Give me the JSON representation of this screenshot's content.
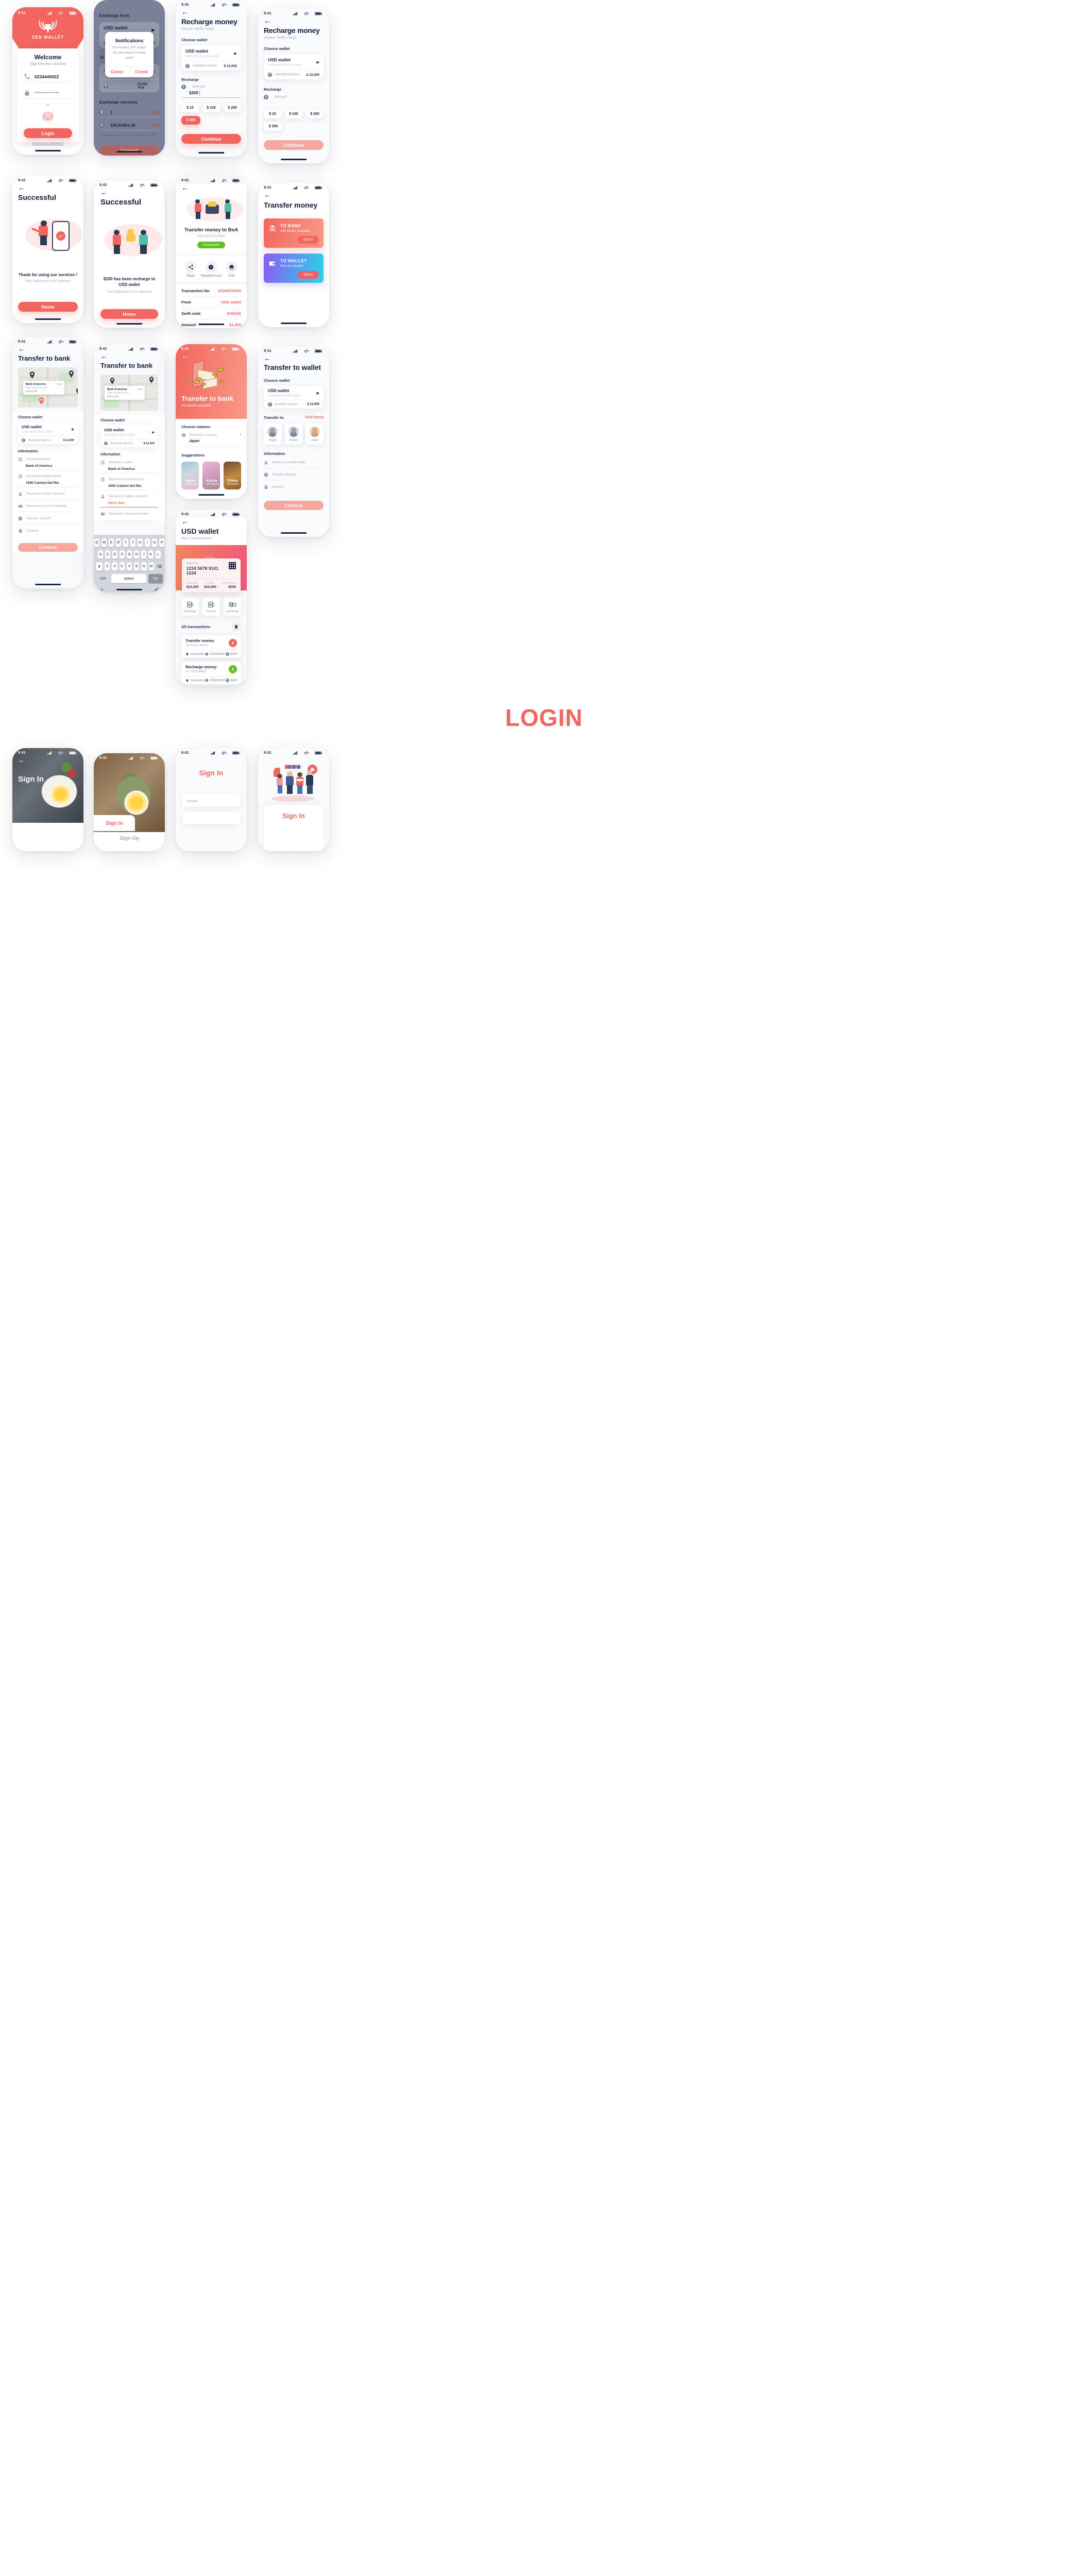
{
  "status_bar": {
    "time": "9:41"
  },
  "screen_login": {
    "brand": "CEN WALLET",
    "welcome_title": "Welcome",
    "welcome_sub": "Sign into your account",
    "phone_value": "0234449922",
    "password_value": "••••••••••••••",
    "or_label": "Or",
    "login_button": "Login",
    "forgot_link": "Forgot your password?"
  },
  "screen_exchange": {
    "from_label": "Exchange from",
    "wallet_name": "USD wallet",
    "wallet_number": "1234  5678  9102  2449",
    "balance_label": "Available balance",
    "balance_value": "$ 12,000",
    "to_label": "To wallet",
    "to_wallet_name": "JPY wallet",
    "to_wallet_number": "1234  5678  9102  2449",
    "to_balance_label": "Available balance",
    "to_balance_value": "10,000 YEN",
    "currency_label": "Exchange currency",
    "amount_from": "1",
    "code_from": "USD",
    "amount_to": "108,84961.00",
    "code_to": "JPY",
    "rate_text": "Exchange rate 1 USD= 108,84961.00 JPY",
    "convert_button": "Convert",
    "dialog": {
      "title": "Notifications",
      "message": "You haven't JPY wallet. Do you want to create now?",
      "cancel": "Cance",
      "create": "Create"
    }
  },
  "screen_recharge_filled": {
    "title": "Recharge money",
    "source": "Source: Wells Fargo",
    "choose_wallet": "Choose wallet",
    "wallet_name": "USD wallet",
    "wallet_number": "1234  5678  9102  2449",
    "balance_label": "Available balance",
    "balance_value": "$ 12,000",
    "recharge_label": "Recharge",
    "amount_placeholder": "Amount",
    "amount_value": "$300",
    "quick_amounts": [
      "$ 10",
      "$ 100",
      "$ 200",
      "$ 300"
    ],
    "selected_amount": "$ 300",
    "continue_button": "Continue"
  },
  "screen_recharge_empty": {
    "title": "Recharge money",
    "source": "Source: Wells Fargo",
    "choose_wallet": "Choose wallet",
    "wallet_name": "USD wallet",
    "wallet_number": "1234  5678  9102  2449",
    "balance_label": "Available balance",
    "balance_value": "$ 12,000",
    "recharge_label": "Recharge",
    "amount_placeholder": "Amount",
    "quick_amounts": [
      "$ 10",
      "$ 100",
      "$ 200",
      "$ 300"
    ],
    "continue_button": "Continue"
  },
  "screen_success_a": {
    "title": "Successful",
    "message": "Thank for using our services !",
    "sub": "Your happiness is our pleasure",
    "home_button": "Home"
  },
  "screen_success_b": {
    "title": "Successful",
    "message_line1": "$100 has been recharge to",
    "message_line2": "USD wallet",
    "sub": "Your happiness is our pleasure",
    "home_button": "Home"
  },
  "screen_transaction": {
    "title": "Transfer money to BoA",
    "datetime": "9:00 AM 1/11/2018",
    "status_badge": "Successful",
    "actions": [
      {
        "label": "Share",
        "icon": "share-icon"
      },
      {
        "label": "Reported issue",
        "icon": "alert-icon"
      },
      {
        "label": "Print",
        "icon": "print-icon"
      }
    ],
    "rows": [
      {
        "key": "Transaction No.",
        "value": "12349576000"
      },
      {
        "key": "From",
        "value": "USD wallet"
      },
      {
        "key": "Swift code",
        "value": "AXD346"
      },
      {
        "key": "Amount",
        "value": "$1,000"
      }
    ]
  },
  "screen_transfer_money": {
    "title": "Transfer money",
    "options": [
      {
        "name": "TO BANK",
        "sub": "244 Banks available",
        "button": "Get in",
        "icon": "bank-icon"
      },
      {
        "name": "TO WALLET",
        "sub": "Free to transfer",
        "button": "Get in",
        "icon": "wallet-icon"
      }
    ]
  },
  "screen_bank_a": {
    "title": "Transfer to bank",
    "map_bank_name": "Bank of america",
    "map_bank_addr": "1640 Camino Del Rio",
    "map_hours": "8:00-17:00",
    "map_link": "Love",
    "choose_wallet": "Choose wallet",
    "wallet_name": "USD wallet",
    "wallet_number": "1234  5678  9102  2449",
    "balance_label": "Available balance",
    "balance_value": "$ 12,000",
    "information": "Information",
    "fields": [
      {
        "label": "Receiver's bank",
        "value": "Bank of America",
        "icon": "bank-icon"
      },
      {
        "label": "Receiver's bank branch",
        "value": "1640 Camino Del Rio",
        "icon": "bank-icon"
      },
      {
        "label": "Receiver's holder account",
        "value": "",
        "icon": "user-icon"
      },
      {
        "label": "Receiver's account number",
        "value": "",
        "icon": "card-icon"
      },
      {
        "label": "Transfer amount",
        "value": "",
        "icon": "coin-icon"
      },
      {
        "label": "Content",
        "value": "",
        "icon": "note-icon"
      }
    ],
    "continue_button": "Continue"
  },
  "screen_bank_b": {
    "title": "Transfer to bank",
    "map_bank_name": "Bank of america",
    "map_bank_addr": "1640 Camino Del Rio",
    "map_hours": "8:00-17:00",
    "map_link": "Love",
    "choose_wallet": "Choose wallet",
    "wallet_name": "USD wallet",
    "wallet_number": "1234  5678  9102  2449",
    "balance_label": "Available balance",
    "balance_value": "$ 12,000",
    "information": "Information",
    "fields": [
      {
        "label": "Receiver's bank",
        "value": "Bank of America",
        "icon": "bank-icon"
      },
      {
        "label": "Receiver's bank branch",
        "value": "1640 Camino Del Rio",
        "icon": "bank-icon"
      },
      {
        "label": "Receiver's holder account",
        "value": "Harry Jam",
        "icon": "user-icon"
      },
      {
        "label": "Receiver's account number",
        "value": "",
        "icon": "card-icon"
      }
    ],
    "keyboard": {
      "row1": [
        "Q",
        "W",
        "E",
        "R",
        "T",
        "Y",
        "U",
        "I",
        "O",
        "P"
      ],
      "row2": [
        "A",
        "S",
        "D",
        "F",
        "G",
        "H",
        "J",
        "K",
        "L"
      ],
      "row3": [
        "Z",
        "X",
        "C",
        "V",
        "B",
        "N",
        "M"
      ],
      "shift": "⬆",
      "backspace": "⌫",
      "numbers": "123",
      "space": "space",
      "go": "Go",
      "emoji": "☺",
      "mic": "🎤"
    }
  },
  "screen_bank_nations": {
    "title": "Transfer to bank",
    "subtitle": "244 Banks available",
    "choose_nations": "Choose nations",
    "nation_label": "Receiver's nations",
    "nation_value": "Japan",
    "suggestions_label": "Suggestions",
    "suggestions": [
      {
        "name": "Japan",
        "banks": "100 banks"
      },
      {
        "name": "Korea",
        "banks": "120 banks"
      },
      {
        "name": "China",
        "banks": "90 banks"
      }
    ]
  },
  "screen_usd_wallet": {
    "title": "USD wallet",
    "subtitle": "Has 3 transactions",
    "card": {
      "wallet_no_label": "Wallet No.",
      "wallet_no": "1234   5678   9101   1234",
      "stats": [
        {
          "label": "INCOMES",
          "value": "$12,200"
        },
        {
          "label": "TOTAL",
          "value": "$12,000"
        },
        {
          "label": "EXPENSES",
          "value": "$200"
        }
      ]
    },
    "quick_actions": [
      {
        "label": "Recharge",
        "icon": "recharge-icon"
      },
      {
        "label": "Transfer",
        "icon": "transfer-icon"
      },
      {
        "label": "Exchange",
        "icon": "exchange-icon"
      }
    ],
    "transactions_label": "All transactions",
    "transactions": [
      {
        "name": "Transfer money",
        "to": "To: Harry James",
        "status": "Successful",
        "date": "09/10/2018",
        "amount": "$200",
        "direction": "out"
      },
      {
        "name": "Recharge money",
        "to": "To: USD wallet",
        "status": "Successful",
        "date": "09/10/2018",
        "amount": "$200",
        "direction": "in"
      }
    ]
  },
  "screen_transfer_wallet": {
    "title": "Transfer to wallet",
    "choose_wallet": "Choose wallet",
    "wallet_name": "USD wallet",
    "wallet_number": "1234  5678  9102  2449",
    "balance_label": "Available balance",
    "balance_value": "$ 12,000",
    "transfer_to_label": "Transfer to",
    "find_friend": "Find friend",
    "friends": [
      "Harry",
      "James",
      "Juliet"
    ],
    "information": "Information",
    "fields": [
      {
        "label": "Receiver's wallet code",
        "icon": "user-icon"
      },
      {
        "label": "Transfer amount",
        "icon": "coin-icon"
      },
      {
        "label": "Content",
        "icon": "note-icon"
      }
    ],
    "continue_button": "Continue"
  },
  "section_login": {
    "heading": "LOGIN"
  },
  "screen_signin_food_a": {
    "title": "Sign In"
  },
  "screen_signin_food_b": {
    "tab_signin": "Sign In",
    "tab_signup": "Sign Up"
  },
  "screen_signin_form": {
    "title": "Sign In",
    "email_placeholder": "Email"
  },
  "screen_signin_illus": {
    "title": "Sign In"
  }
}
